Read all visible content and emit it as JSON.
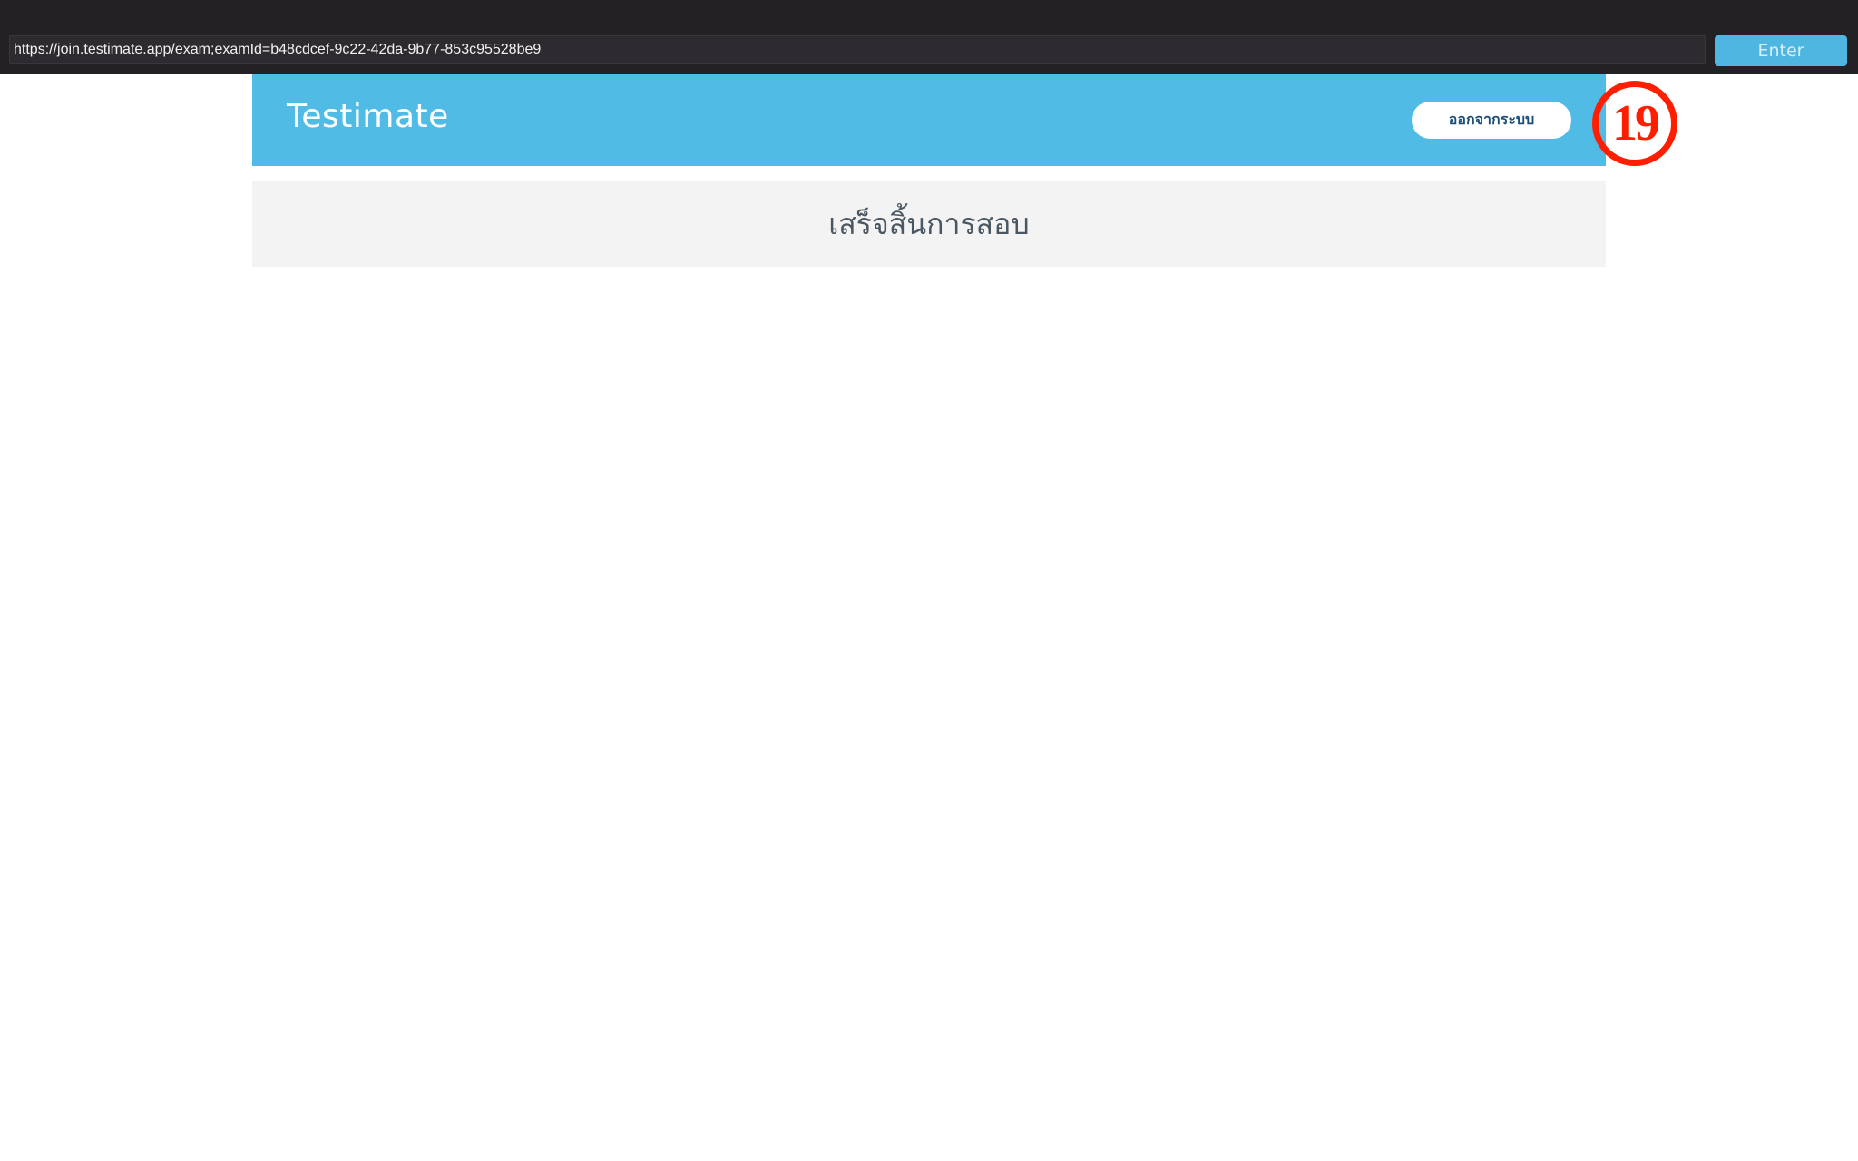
{
  "browser": {
    "url": "https://join.testimate.app/exam;examId=b48cdcef-9c22-42da-9b77-853c95528be9",
    "enter_label": "Enter"
  },
  "header": {
    "brand": "Testimate",
    "logout_label": "ออกจากระบบ"
  },
  "annotation": {
    "step_number": "19"
  },
  "main": {
    "status": "เสร็จสิ้นการสอบ"
  },
  "colors": {
    "topbar": "#242125",
    "accent": "#50bce6",
    "badge": "#ff1f00",
    "panel": "#f3f3f3"
  }
}
